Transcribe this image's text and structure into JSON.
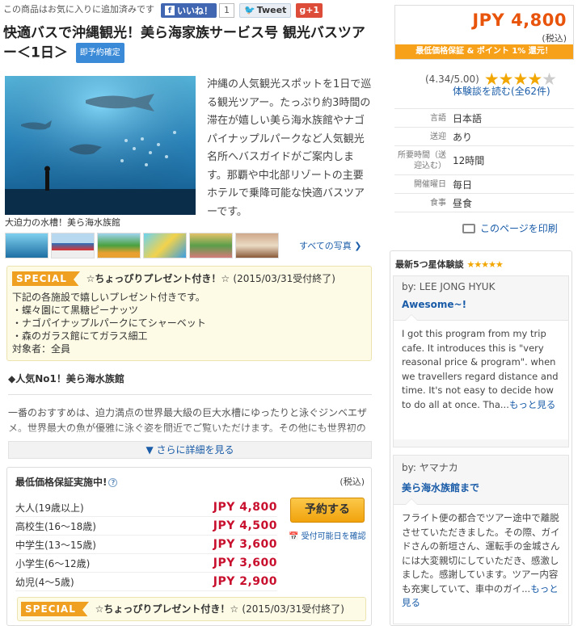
{
  "header": {
    "fav_text": "この商品はお気に入りに追加済みです",
    "fb_label": "いいね！",
    "fb_count": "1",
    "tweet_label": "Tweet",
    "gplus_label": "g+1"
  },
  "tour": {
    "title": "快適バスで沖縄観光！美ら海家族サービス号 観光バスツアー＜1日＞",
    "instant_badge": "即予約確定",
    "description": "沖縄の人気観光スポットを1日で巡る観光ツアー。たっぷり約3時間の滞在が嬉しい美ら海水族館やナゴパイナップルパークなど人気観光名所へバスガイドがご案内します。那覇や中北部リゾートの主要ホテルで乗降可能な快適バスツアーです。",
    "photo_caption": "大迫力の水槽！美ら海水族館",
    "all_photos": "すべての写真"
  },
  "special": {
    "tag": "SPECIAL",
    "title": "☆ちょっぴりプレゼント付き！☆",
    "date": "(2015/03/31受付終了)",
    "lines": [
      "下記の各施設で嬉しいプレゼント付きです。",
      "・蝶々園にて黒糖ピーナッツ",
      "・ナゴパイナップルパークにてシャーベット",
      "・森のガラス館にてガラス細工",
      "対象者：全員"
    ]
  },
  "section": {
    "heading": "◆人気No1！美ら海水族館",
    "body": "一番のおすすめは、迫力満点の世界最大級の巨大水槽にゆったりと泳ぐジンベエザメ。世界最大の魚が優雅に泳ぐ姿を間近でご覧いただけます。その他にも世界初の技術となったマンタとの複数飼育や、生きたサンゴ礁の大規模展示などが行",
    "more_label": "▼ さらに詳細を見る"
  },
  "pricing": {
    "heading": "最低価格保証実施中!",
    "tax_note": "(税込)",
    "rows": [
      {
        "age": "大人(19歳以上)",
        "amount": "JPY 4,800"
      },
      {
        "age": "高校生(16〜18歳)",
        "amount": "JPY 4,500"
      },
      {
        "age": "中学生(13〜15歳)",
        "amount": "JPY 3,600"
      },
      {
        "age": "小学生(6〜12歳)",
        "amount": "JPY 3,600"
      },
      {
        "age": "幼児(4〜5歳)",
        "amount": "JPY 2,900"
      }
    ],
    "reserve_label": "予約する",
    "check_days": "受付可能日を確認"
  },
  "sidebar": {
    "price": "JPY 4,800",
    "tax": "(税込)",
    "guarantee": "最低価格保証 & ポイント 1% 還元！",
    "rating_text": "(4.34/5.00)",
    "rating_value": 4.34,
    "review_link": "体験談を読む",
    "review_total": "(全62件)",
    "specs": [
      {
        "k": "言語",
        "v": "日本語"
      },
      {
        "k": "送迎",
        "v": "あり"
      },
      {
        "k": "所要時間（送迎込む）",
        "v": "12時間"
      },
      {
        "k": "開催曜日",
        "v": "毎日"
      },
      {
        "k": "食事",
        "v": "昼食"
      }
    ],
    "print_label": "このページを印刷",
    "reviews_heading": "最新5つ星体験談",
    "reviews": [
      {
        "by": "by: LEE JONG HYUK",
        "title": "Awesome~!",
        "body": "I got this program from my trip cafe. It introduces this is \"very reasonal price & program\". when we travellers regard distance and time. It's not easy to decide how to do all at once. Tha...",
        "more": "もっと見る"
      },
      {
        "by": "by: ヤマナカ",
        "title": "美ら海水族館まで",
        "body": "フライト便の都合でツアー途中で離脱させていただきました。その際、ガイドさんの新垣さん、運転手の金城さんには大変親切にしていただき、感激しました。感謝しています。ツアー内容も充実していて、車中のガイ...",
        "more": "もっと見る"
      }
    ]
  },
  "colors": {
    "price_red": "#c8102e",
    "accent_orange": "#f7a11a",
    "link_blue": "#1a5ca8",
    "special_bg": "#fdfbe6"
  }
}
